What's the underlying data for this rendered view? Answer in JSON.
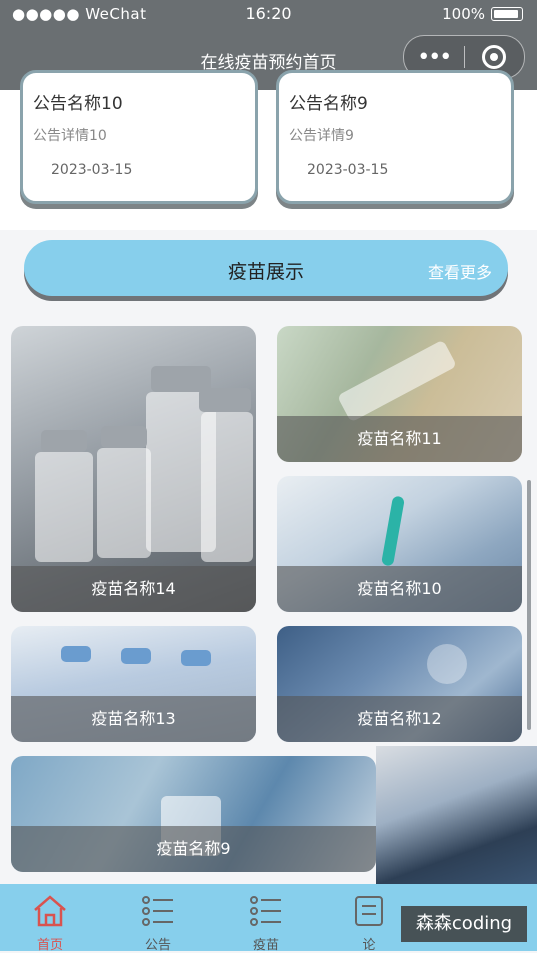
{
  "status_bar": {
    "carrier": "●●●●● WeChat",
    "time": "16:20",
    "battery": "100%"
  },
  "nav": {
    "title": "在线疫苗预约首页",
    "more_icon": "•••",
    "close_icon": "target-icon"
  },
  "notices": [
    {
      "title": "公告名称10",
      "detail": "公告详情10",
      "date": "2023-03-15"
    },
    {
      "title": "公告名称9",
      "detail": "公告详情9",
      "date": "2023-03-15"
    }
  ],
  "vaccine_section": {
    "title": "疫苗展示",
    "more_label": "查看更多"
  },
  "vaccines": [
    {
      "name": "疫苗名称14"
    },
    {
      "name": "疫苗名称11"
    },
    {
      "name": "疫苗名称10"
    },
    {
      "name": "疫苗名称13"
    },
    {
      "name": "疫苗名称12"
    },
    {
      "name": "疫苗名称9"
    }
  ],
  "tabbar": {
    "tabs": [
      {
        "label": "首页",
        "icon": "home-icon",
        "active": true
      },
      {
        "label": "公告",
        "icon": "list-icon"
      },
      {
        "label": "疫苗",
        "icon": "list-icon"
      },
      {
        "label": "论",
        "icon": "list-icon"
      }
    ]
  },
  "watermark": "森森coding",
  "colors": {
    "accent": "#87cfec",
    "active_tab": "#d9534f",
    "nav_bg": "#6a6f72"
  }
}
